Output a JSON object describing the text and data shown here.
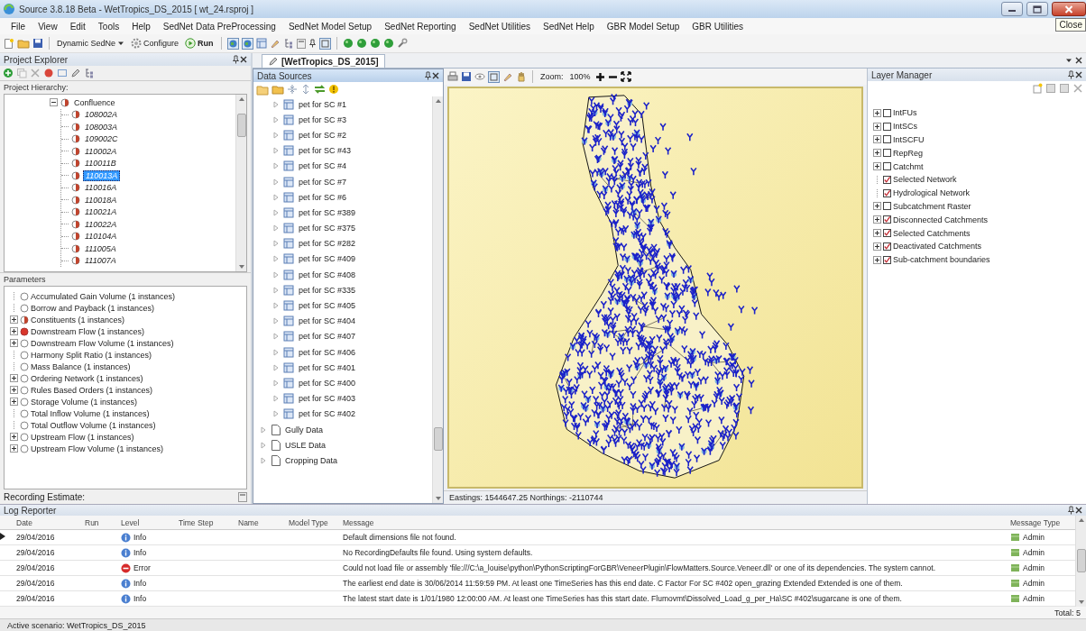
{
  "window": {
    "title": "Source 3.8.18 Beta - WetTropics_DS_2015 [ wt_24.rsproj ]",
    "tooltip": "Close"
  },
  "menu": [
    "File",
    "View",
    "Edit",
    "Tools",
    "Help",
    "SedNet Data PreProcessing",
    "SedNet Model Setup",
    "SedNet Reporting",
    "SedNet Utilities",
    "SedNet Help",
    "GBR Model Setup",
    "GBR Utilities"
  ],
  "toolbar": {
    "scenario": "Dynamic SedNe",
    "configure": "Configure",
    "run": "Run"
  },
  "project_explorer": {
    "title": "Project Explorer",
    "hierarchy_label": "Project Hierarchy:",
    "hierarchy": [
      {
        "label": "Confluence",
        "expanded": true,
        "children": [
          {
            "label": "108002A",
            "selected": false
          },
          {
            "label": "108003A",
            "selected": false
          },
          {
            "label": "109002C",
            "selected": false
          },
          {
            "label": "110002A",
            "selected": false
          },
          {
            "label": "110011B",
            "selected": false
          },
          {
            "label": "110013A",
            "selected": true
          },
          {
            "label": "110016A",
            "selected": false
          },
          {
            "label": "110018A",
            "selected": false
          },
          {
            "label": "110021A",
            "selected": false
          },
          {
            "label": "110022A",
            "selected": false
          },
          {
            "label": "110104A",
            "selected": false
          },
          {
            "label": "111005A",
            "selected": false
          },
          {
            "label": "111007A",
            "selected": false
          }
        ]
      }
    ],
    "parameters_label": "Parameters",
    "parameters": [
      {
        "label": "Accumulated Gain Volume (1 instances)",
        "expandable": false,
        "kind": "empty"
      },
      {
        "label": "Borrow and Payback (1 instances)",
        "expandable": false,
        "kind": "empty"
      },
      {
        "label": "Constituents (1 instances)",
        "expandable": true,
        "kind": "half"
      },
      {
        "label": "Downstream Flow (1 instances)",
        "expandable": true,
        "kind": "full"
      },
      {
        "label": "Downstream Flow Volume (1 instances)",
        "expandable": true,
        "kind": "empty"
      },
      {
        "label": "Harmony Split Ratio (1 instances)",
        "expandable": false,
        "kind": "empty"
      },
      {
        "label": "Mass Balance (1 instances)",
        "expandable": false,
        "kind": "empty"
      },
      {
        "label": "Ordering Network (1 instances)",
        "expandable": true,
        "kind": "empty"
      },
      {
        "label": "Rules Based Orders (1 instances)",
        "expandable": true,
        "kind": "empty"
      },
      {
        "label": "Storage Volume (1 instances)",
        "expandable": true,
        "kind": "empty"
      },
      {
        "label": "Total Inflow Volume (1 instances)",
        "expandable": false,
        "kind": "empty"
      },
      {
        "label": "Total Outflow Volume (1 instances)",
        "expandable": false,
        "kind": "empty"
      },
      {
        "label": "Upstream Flow (1 instances)",
        "expandable": true,
        "kind": "empty"
      },
      {
        "label": "Upstream Flow Volume (1 instances)",
        "expandable": true,
        "kind": "empty"
      }
    ],
    "recording_label": "Recording Estimate:"
  },
  "document_tab": {
    "label": "[WetTropics_DS_2015]",
    "selected": true
  },
  "data_sources": {
    "title": "Data Sources",
    "items": [
      {
        "label": "pet for SC #1",
        "kind": "table"
      },
      {
        "label": "pet for SC #3",
        "kind": "table"
      },
      {
        "label": "pet for SC #2",
        "kind": "table"
      },
      {
        "label": "pet for SC #43",
        "kind": "table"
      },
      {
        "label": "pet for SC #4",
        "kind": "table"
      },
      {
        "label": "pet for SC #7",
        "kind": "table"
      },
      {
        "label": "pet for SC #6",
        "kind": "table"
      },
      {
        "label": "pet for SC #389",
        "kind": "table"
      },
      {
        "label": "pet for SC #375",
        "kind": "table"
      },
      {
        "label": "pet for SC #282",
        "kind": "table"
      },
      {
        "label": "pet for SC #409",
        "kind": "table"
      },
      {
        "label": "pet for SC #408",
        "kind": "table"
      },
      {
        "label": "pet for SC #335",
        "kind": "table"
      },
      {
        "label": "pet for SC #405",
        "kind": "table"
      },
      {
        "label": "pet for SC #404",
        "kind": "table"
      },
      {
        "label": "pet for SC #407",
        "kind": "table"
      },
      {
        "label": "pet for SC #406",
        "kind": "table"
      },
      {
        "label": "pet for SC #401",
        "kind": "table"
      },
      {
        "label": "pet for SC #400",
        "kind": "table"
      },
      {
        "label": "pet for SC #403",
        "kind": "table"
      },
      {
        "label": "pet for SC #402",
        "kind": "table"
      },
      {
        "label": "Gully Data",
        "kind": "folder"
      },
      {
        "label": "USLE Data",
        "kind": "folder"
      },
      {
        "label": "Cropping Data",
        "kind": "folder"
      }
    ]
  },
  "map": {
    "zoom_label": "Zoom:",
    "zoom_value": "100%",
    "status": "Eastings: 1544647.25 Northings: -2110744"
  },
  "layer_manager": {
    "title": "Layer Manager",
    "layers": [
      {
        "label": "IntFUs",
        "checked": false,
        "expandable": true
      },
      {
        "label": "IntSCs",
        "checked": false,
        "expandable": true
      },
      {
        "label": "IntSCFU",
        "checked": false,
        "expandable": true
      },
      {
        "label": "RepReg",
        "checked": false,
        "expandable": true
      },
      {
        "label": "Catchmt",
        "checked": false,
        "expandable": true
      },
      {
        "label": "Selected Network",
        "checked": true,
        "expandable": false
      },
      {
        "label": "Hydrological Network",
        "checked": true,
        "expandable": false
      },
      {
        "label": "Subcatchment Raster",
        "checked": false,
        "expandable": true
      },
      {
        "label": "Disconnected Catchments",
        "checked": true,
        "expandable": true
      },
      {
        "label": "Selected Catchments",
        "checked": true,
        "expandable": true
      },
      {
        "label": "Deactivated Catchments",
        "checked": true,
        "expandable": true
      },
      {
        "label": "Sub-catchment boundaries",
        "checked": true,
        "expandable": true
      }
    ]
  },
  "log": {
    "title": "Log Reporter",
    "columns": [
      "Date",
      "Run",
      "Level",
      "Time Step",
      "Name",
      "Model Type",
      "Message",
      "Message Type"
    ],
    "rows": [
      {
        "selected": true,
        "date": "29/04/2016",
        "level": "Info",
        "kind": "info",
        "message": "Default dimensions file not found.",
        "message_type": "Admin"
      },
      {
        "selected": false,
        "date": "29/04/2016",
        "level": "Info",
        "kind": "info",
        "message": "No RecordingDefaults file found. Using system defaults.",
        "message_type": "Admin"
      },
      {
        "selected": false,
        "date": "29/04/2016",
        "level": "Error",
        "kind": "error",
        "message": "Could not load file or assembly 'file:///C:\\a_louise\\python\\PythonScriptingForGBR\\VeneerPlugin\\FlowMatters.Source.Veneer.dll' or one of its dependencies. The system cannot.",
        "message_type": "Admin"
      },
      {
        "selected": false,
        "date": "29/04/2016",
        "level": "Info",
        "kind": "info",
        "message": "The earliest end date is 30/06/2014 11:59:59 PM. At least one TimeSeries has this end date. C Factor For SC #402 open_grazing Extended Extended is one of them.",
        "message_type": "Admin"
      },
      {
        "selected": false,
        "date": "29/04/2016",
        "level": "Info",
        "kind": "info",
        "message": "The latest start date is 1/01/1980 12:00:00 AM. At least one TimeSeries has this start date. Flumovmt\\Dissolved_Load_g_per_Ha\\SC #402\\sugarcane is one of them.",
        "message_type": "Admin"
      }
    ],
    "total": "Total: 5"
  },
  "status_bar": {
    "text": "Active scenario: WetTropics_DS_2015"
  }
}
